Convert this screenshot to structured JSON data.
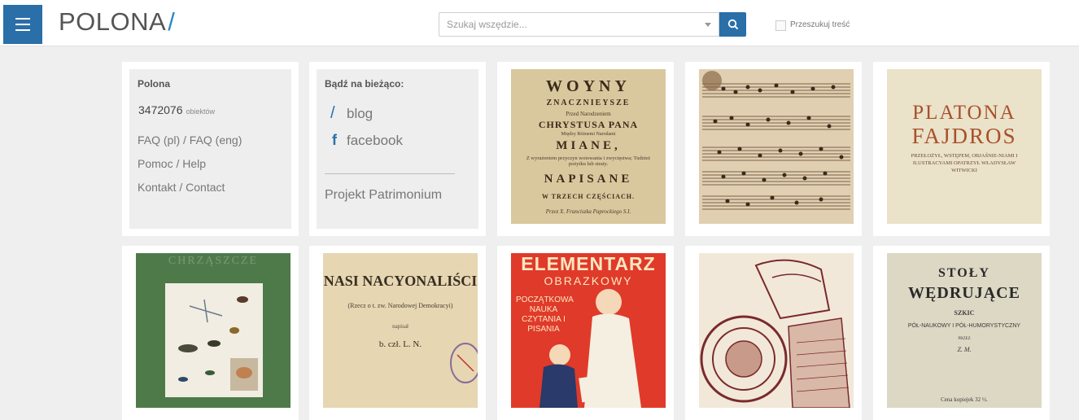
{
  "header": {
    "logo": "POLONA",
    "logo_slash": "/",
    "search_placeholder": "Szukaj wszędzie...",
    "search_content_label": "Przeszukuj treść"
  },
  "info_card": {
    "title": "Polona",
    "count": "3472076",
    "count_unit": "obiektów",
    "links": [
      "FAQ (pl) / FAQ (eng)",
      "Pomoc / Help",
      "Kontakt / Contact"
    ]
  },
  "social_card": {
    "title": "Bądź na bieżąco:",
    "blog": "blog",
    "facebook": "facebook",
    "project": "Projekt Patrimonium"
  },
  "books": {
    "woyny": {
      "l1": "WOYNY",
      "l2": "ZNACZNIEYSZE",
      "l3": "Przed Narodzeniem",
      "l4": "CHRYSTUSA PANA",
      "l5": "Między Różnemi Narodami",
      "l6": "MIANE,",
      "l7": "Z wyrażeniem przyczyn woiowania i zwycięstwa; Tudzież pożytku lub straty.",
      "l8": "NAPISANE",
      "l9": "W TRZECH CZĘŚCIACH.",
      "l10": "Przez X. Franciszka Paprockiego S.I."
    },
    "platona": {
      "l1": "PLATONA",
      "l2": "FAJDROS",
      "l3": "PRZEŁOŻYŁ, WSTĘPEM, OBJAŚNIE-NIAMI I ILUSTRACYAMI OPATRZYŁ WŁADYSŁAW WITWICKI"
    },
    "chrzaszcze": {
      "l1": "CHRZĄSZCZE"
    },
    "nasi": {
      "l1": "NASI NACYONALIŚCI",
      "l2": "(Rzecz o t. zw. Narodowej Demokracyi)",
      "l3": "napisał",
      "l4": "b. czł. L. N."
    },
    "elementarz": {
      "l1": "ELEMENTARZ",
      "l2": "OBRAZKOWY",
      "l3": "POCZĄTKOWA NAUKA CZYTANIA I PISANIA"
    },
    "stoly": {
      "l1": "STOŁY",
      "l2": "WĘDRUJĄCE",
      "l3": "SZKIC",
      "l4": "PÓŁ-NAUKOWY I PÓŁ-HUMORYSTYCZNY",
      "l5": "PRZEZ",
      "l6": "Z. M.",
      "l7": "Cena kopiejek 32 ½."
    }
  }
}
